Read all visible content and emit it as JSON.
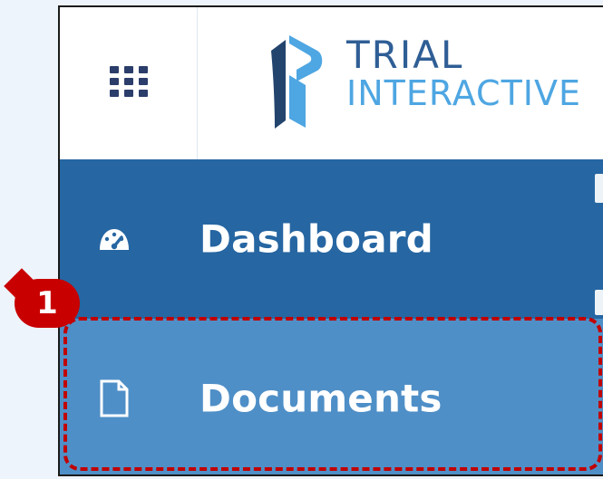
{
  "brand": {
    "line1": "TRIAL",
    "line2": "INTERACTIVE",
    "icon_name": "trial-interactive-logo",
    "primary_color": "#2f5e95",
    "secondary_color": "#4ea6e2"
  },
  "header": {
    "app_launcher_icon": "grid-icon"
  },
  "sidebar": {
    "items": [
      {
        "label": "Dashboard",
        "icon": "dashboard-icon",
        "background": "#2666a2"
      },
      {
        "label": "Documents",
        "icon": "document-icon",
        "background": "#4f8fc7"
      }
    ]
  },
  "annotation": {
    "badge_text": "1",
    "color": "#c80000"
  }
}
